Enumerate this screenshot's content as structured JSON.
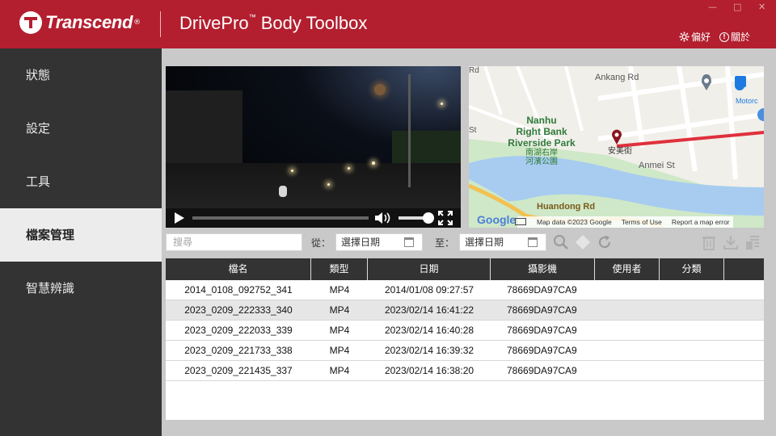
{
  "header": {
    "brand": "Transcend",
    "brand_reg": "®",
    "title": "DrivePro",
    "title_tm": "™",
    "title_rest": " Body Toolbox",
    "preferences": "偏好",
    "about": "關於",
    "window_controls": [
      "—",
      "□",
      "✕"
    ]
  },
  "sidebar": {
    "items": [
      {
        "label": "狀態",
        "active": false
      },
      {
        "label": "設定",
        "active": false
      },
      {
        "label": "工具",
        "active": false
      },
      {
        "label": "檔案管理",
        "active": true
      },
      {
        "label": "智慧辨識",
        "active": false
      }
    ]
  },
  "map": {
    "park_en": "Nanhu Right Bank Riverside Park",
    "park_en_l1": "Nanhu",
    "park_en_l2": "Right Bank",
    "park_en_l3": "Riverside Park",
    "park_zh_l1": "南湖右岸",
    "park_zh_l2": "河濱公園",
    "road_ankang": "Ankang Rd",
    "road_anmei": "Anmei St",
    "road_st": "St",
    "road_rd": "Rd",
    "road_huandong": "Huandong Rd",
    "road_zh": "安美街",
    "poi_motor": "Motorc",
    "google": "Google",
    "attribution": [
      "Map data ©2023 Google",
      "Terms of Use",
      "Report a map error"
    ]
  },
  "filter": {
    "search_placeholder": "搜尋",
    "from_label": "從：",
    "to_label": "至：",
    "from_date": "選擇日期",
    "to_date": "選擇日期"
  },
  "table": {
    "headers": [
      "檔名",
      "類型",
      "日期",
      "攝影機",
      "使用者",
      "分類",
      ""
    ],
    "rows": [
      [
        "2014_0108_092752_341",
        "MP4",
        "2014/01/08 09:27:57",
        "78669DA97CA9",
        "",
        "",
        ""
      ],
      [
        "2023_0209_222333_340",
        "MP4",
        "2023/02/14 16:41:22",
        "78669DA97CA9",
        "",
        "",
        ""
      ],
      [
        "2023_0209_222033_339",
        "MP4",
        "2023/02/14 16:40:28",
        "78669DA97CA9",
        "",
        "",
        ""
      ],
      [
        "2023_0209_221733_338",
        "MP4",
        "2023/02/14 16:39:32",
        "78669DA97CA9",
        "",
        "",
        ""
      ],
      [
        "2023_0209_221435_337",
        "MP4",
        "2023/02/14 16:38:20",
        "78669DA97CA9",
        "",
        "",
        ""
      ]
    ]
  },
  "colors": {
    "header_red": "#b31f2f",
    "sidebar": "#333333",
    "route": "#e0303c"
  }
}
